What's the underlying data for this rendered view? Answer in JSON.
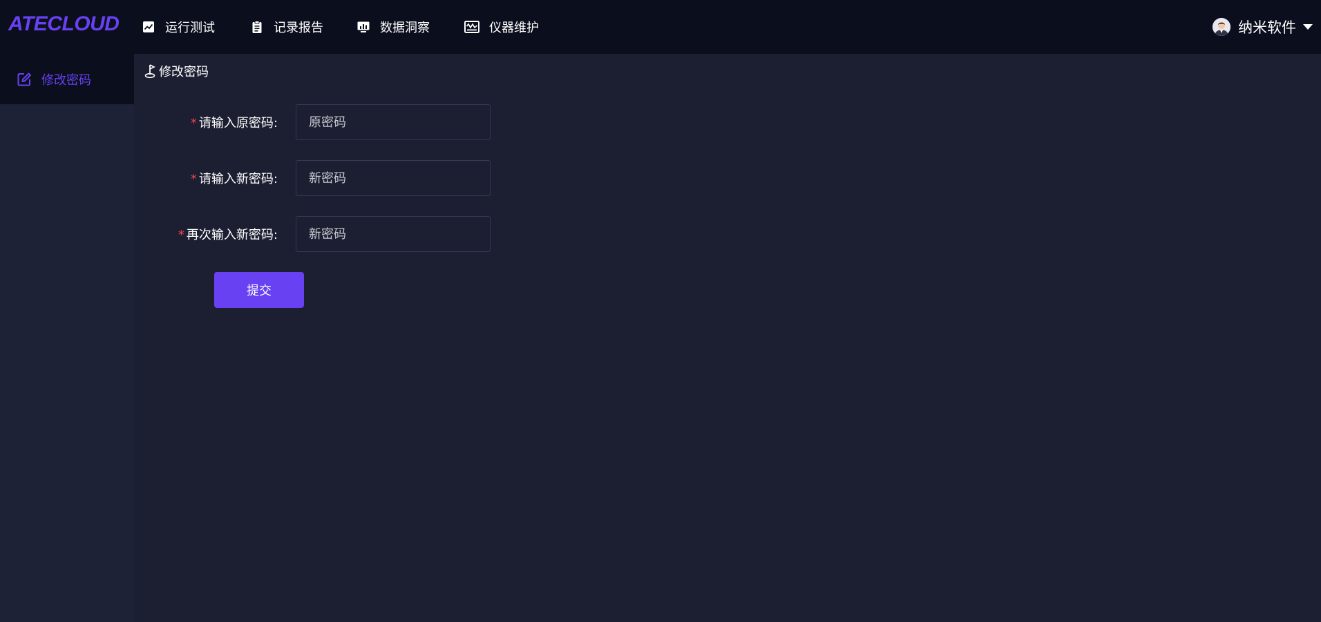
{
  "app": {
    "logo": "ATECLOUD"
  },
  "nav": {
    "items": [
      {
        "label": "运行测试",
        "icon": "chart-line-icon"
      },
      {
        "label": "记录报告",
        "icon": "clipboard-icon"
      },
      {
        "label": "数据洞察",
        "icon": "bar-chart-monitor-icon"
      },
      {
        "label": "仪器维护",
        "icon": "oscilloscope-icon"
      }
    ]
  },
  "user": {
    "name": "纳米软件",
    "avatar": "user-avatar"
  },
  "sidebar": {
    "items": [
      {
        "label": "修改密码",
        "icon": "edit-icon",
        "active": true
      }
    ]
  },
  "breadcrumb": {
    "label": "修改密码",
    "icon": "flag-icon"
  },
  "form": {
    "old_password": {
      "label": "请输入原密码:",
      "placeholder": "原密码",
      "value": ""
    },
    "new_password": {
      "label": "请输入新密码:",
      "placeholder": "新密码",
      "value": ""
    },
    "confirm_password": {
      "label": "再次输入新密码:",
      "placeholder": "新密码",
      "value": ""
    },
    "required_mark": "*",
    "submit_label": "提交"
  },
  "colors": {
    "accent": "#6741f2",
    "topbar": "#0b0e1d",
    "background": "#1c1f31",
    "sidebar": "#1e2236",
    "required": "#f0444d"
  }
}
